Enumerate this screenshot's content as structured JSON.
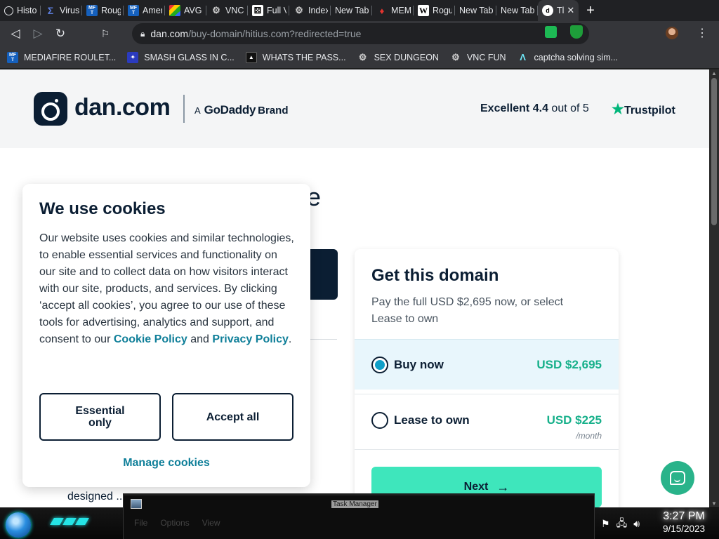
{
  "browser": {
    "tabs": [
      {
        "icon": "history-icon",
        "label": "Histo"
      },
      {
        "icon": "sigma-icon",
        "label": "Virus"
      },
      {
        "icon": "mediafire-icon",
        "label": "Roug"
      },
      {
        "icon": "mediafire-icon",
        "label": "Amer"
      },
      {
        "icon": "avg-icon",
        "label": "AVG"
      },
      {
        "icon": "vnc-icon",
        "label": "VNC"
      },
      {
        "icon": "dice-icon",
        "label": "Full V"
      },
      {
        "icon": "vnc-icon",
        "label": "Index"
      },
      {
        "icon": "",
        "label": "New Tab"
      },
      {
        "icon": "meme-icon",
        "label": "MEM"
      },
      {
        "icon": "wikipedia-icon",
        "label": "Rogu"
      },
      {
        "icon": "",
        "label": "New Tab"
      },
      {
        "icon": "",
        "label": "New Tab"
      },
      {
        "icon": "dan-icon",
        "label": "Tl",
        "active": true
      }
    ],
    "url_host": "dan.com",
    "url_path": "/buy-domain/hitius.com?redirected=true",
    "bookmarks": [
      {
        "icon": "mediafire-icon",
        "label": "MEDIAFIRE ROULET..."
      },
      {
        "icon": "shatter-icon",
        "label": "SMASH GLASS IN C..."
      },
      {
        "icon": "password-icon",
        "label": "WHATS THE PASS..."
      },
      {
        "icon": "vnc-icon",
        "label": "SEX DUNGEON"
      },
      {
        "icon": "vnc-icon",
        "label": "VNC FUN"
      },
      {
        "icon": "captcha-icon",
        "label": "captcha solving sim..."
      }
    ]
  },
  "site": {
    "logo_text": "dan.com",
    "brand_a": "A",
    "brand_godaddy": "GoDaddy",
    "brand_word": "Brand",
    "rating_word": "Excellent",
    "rating_score": "4.4",
    "rating_suffix": "out of 5",
    "trustpilot": "Trustpilot",
    "hero_fragment": "e",
    "body_fragment": "designed ..."
  },
  "card": {
    "title": "Get this domain",
    "subtitle": "Pay the full USD $2,695 now, or select Lease to own",
    "options": [
      {
        "label": "Buy now",
        "price": "USD $2,695",
        "unit": "",
        "selected": true
      },
      {
        "label": "Lease to own",
        "price": "USD $225",
        "unit": "/month",
        "selected": false
      }
    ],
    "next_label": "Next"
  },
  "cookie": {
    "title": "We use cookies",
    "body": "Our website uses cookies and similar technologies, to enable essential services and functionality on our site and to collect data on how visitors interact with our site, products, and services. By clicking ‘accept all cookies’, you agree to our use of these tools for advertising, analytics and support, and consent to our",
    "link1": "Cookie Policy",
    "and": "and",
    "link2": "Privacy Policy",
    "end": ".",
    "essential_label": "Essential only",
    "accept_label": "Accept all",
    "manage_label": "Manage cookies"
  },
  "taskbar": {
    "window_title": "Task Manager",
    "menu": [
      "File",
      "Options",
      "View"
    ],
    "time": "3:27 PM",
    "date": "9/15/2023"
  },
  "colors": {
    "brand_navy": "#0b1e33",
    "accent_teal": "#3ee6bc",
    "link_teal": "#0f7f99",
    "price_green": "#16b08a",
    "trustpilot_green": "#00b67a"
  }
}
